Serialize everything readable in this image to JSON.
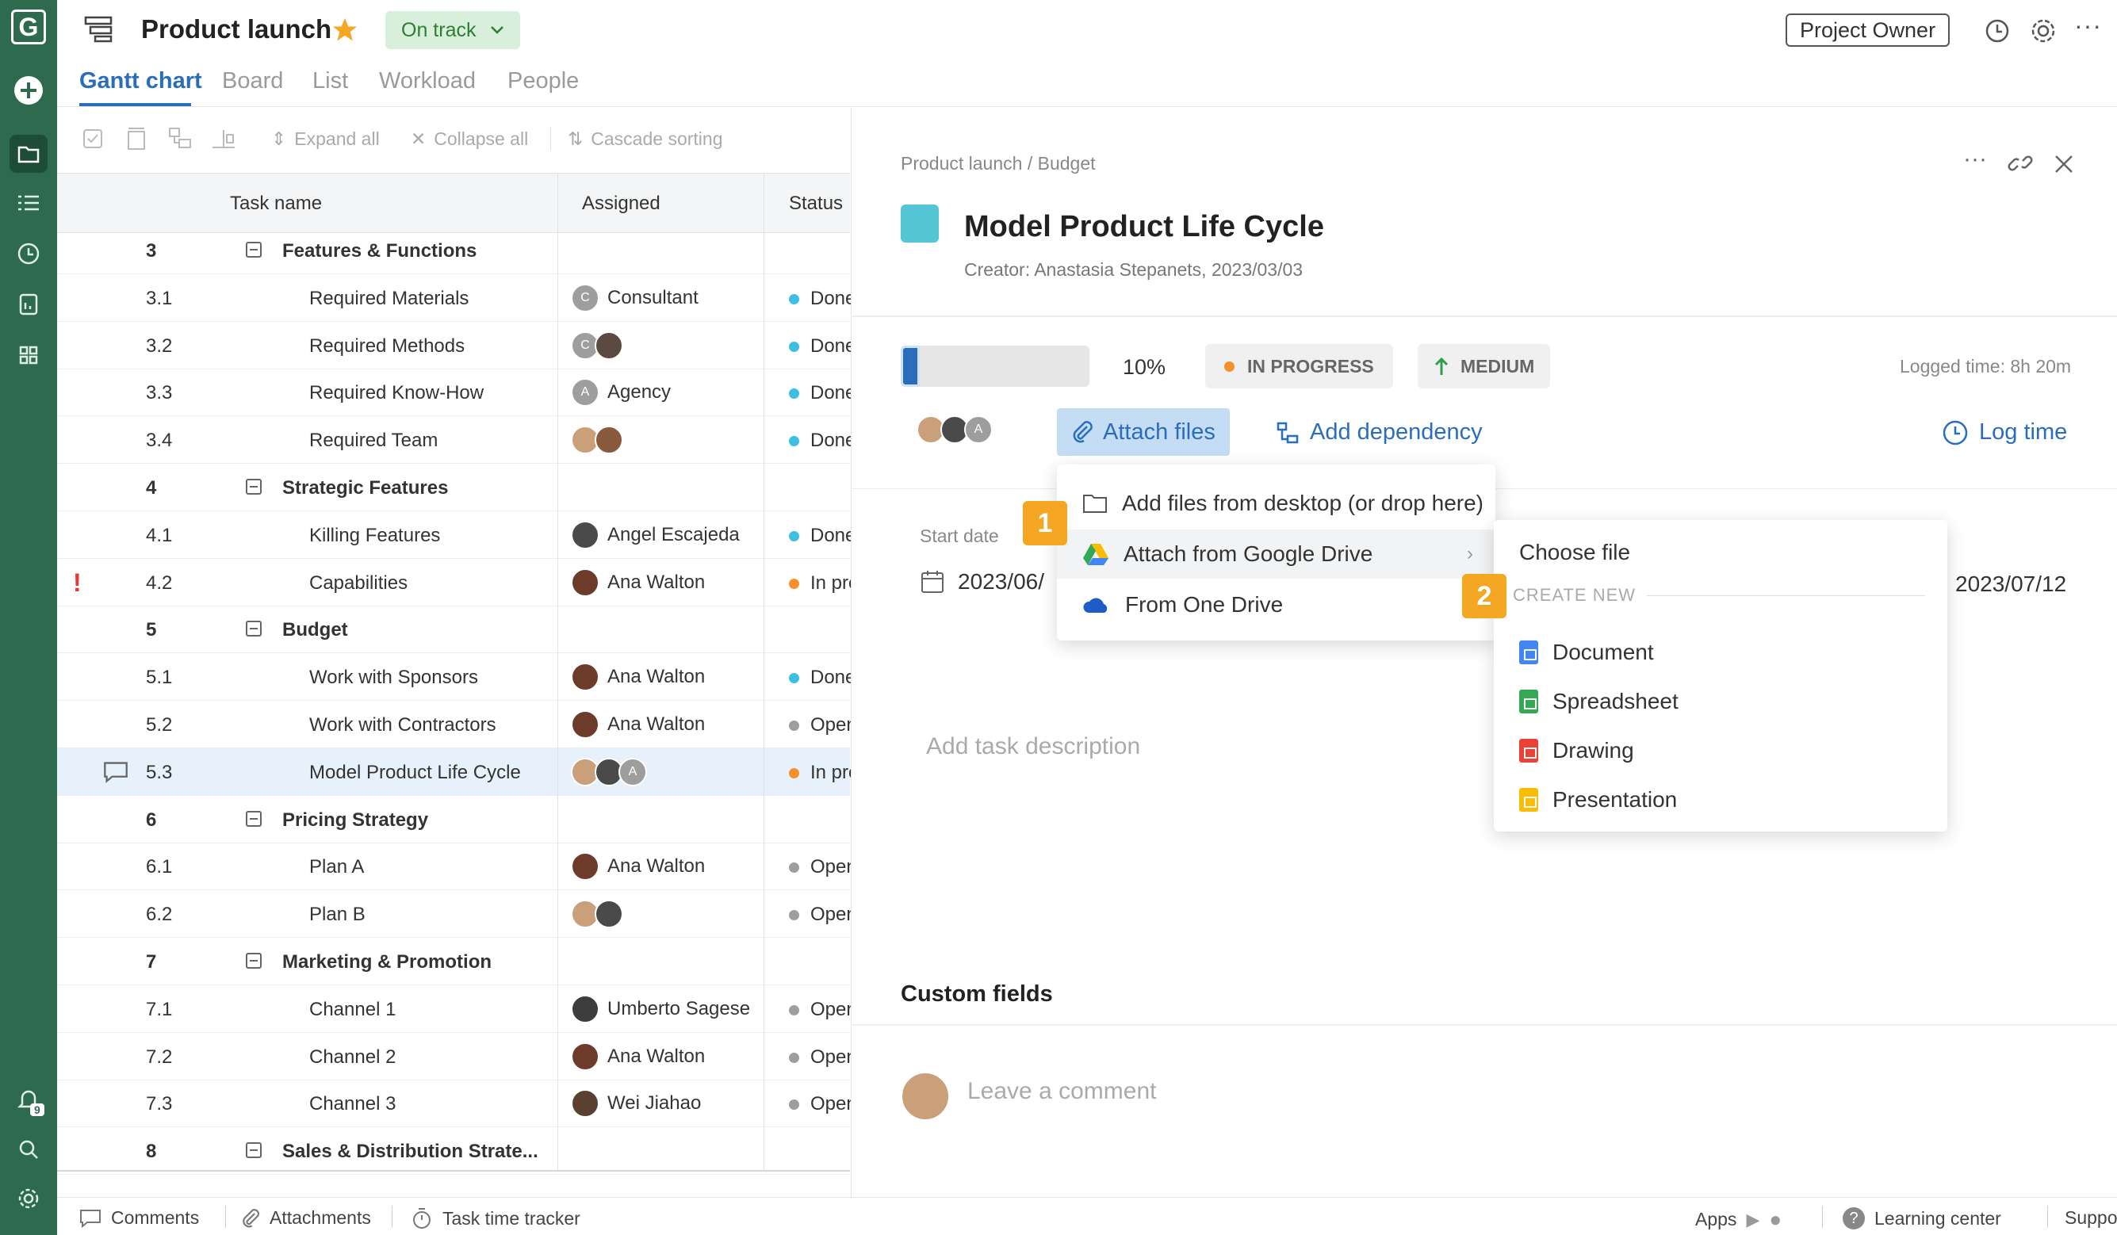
{
  "app": {
    "logo": "G",
    "title": "Product launch",
    "status": "On track",
    "role": "Project Owner",
    "notification_count": "9"
  },
  "tabs": [
    "Gantt chart",
    "Board",
    "List",
    "Workload",
    "People"
  ],
  "toolbar": {
    "expand_all": "Expand all",
    "collapse_all": "Collapse all",
    "cascade_sorting": "Cascade sorting"
  },
  "grid": {
    "columns": [
      "Task name",
      "Assigned",
      "Status"
    ],
    "rows": [
      {
        "num": "3",
        "name": "Features & Functions",
        "parent": true
      },
      {
        "num": "3.1",
        "name": "Required Materials",
        "assignee": "Consultant",
        "avatars": [
          {
            "letter": "C",
            "color": "#9e9e9e"
          }
        ],
        "status": "Done",
        "status_color": "#3cbfe0"
      },
      {
        "num": "3.2",
        "name": "Required Methods",
        "avatars": [
          {
            "letter": "C",
            "color": "#9e9e9e"
          },
          {
            "letter": "",
            "color": "#5b4a3f"
          }
        ],
        "status": "Done",
        "status_color": "#3cbfe0"
      },
      {
        "num": "3.3",
        "name": "Required Know-How",
        "assignee": "Agency",
        "avatars": [
          {
            "letter": "A",
            "color": "#9e9e9e"
          }
        ],
        "status": "Done",
        "status_color": "#3cbfe0"
      },
      {
        "num": "3.4",
        "name": "Required Team",
        "avatars": [
          {
            "letter": "",
            "color": "#c9a07a"
          },
          {
            "letter": "",
            "color": "#8a5a3e"
          }
        ],
        "status": "Done",
        "status_color": "#3cbfe0"
      },
      {
        "num": "4",
        "name": "Strategic Features",
        "parent": true
      },
      {
        "num": "4.1",
        "name": "Killing Features",
        "assignee": "Angel Escajeda",
        "avatars": [
          {
            "letter": "",
            "color": "#4a4a4a"
          }
        ],
        "status": "Done",
        "status_color": "#3cbfe0"
      },
      {
        "num": "4.2",
        "name": "Capabilities",
        "assignee": "Ana Walton",
        "avatars": [
          {
            "letter": "",
            "color": "#6d3b2a"
          }
        ],
        "status": "In progress",
        "status_color": "#f5902a",
        "flag": "!"
      },
      {
        "num": "5",
        "name": "Budget",
        "parent": true
      },
      {
        "num": "5.1",
        "name": "Work with Sponsors",
        "assignee": "Ana Walton",
        "avatars": [
          {
            "letter": "",
            "color": "#6d3b2a"
          }
        ],
        "status": "Done",
        "status_color": "#3cbfe0"
      },
      {
        "num": "5.2",
        "name": "Work with Contractors",
        "assignee": "Ana Walton",
        "avatars": [
          {
            "letter": "",
            "color": "#6d3b2a"
          }
        ],
        "status": "Open",
        "status_color": "#9e9e9e"
      },
      {
        "num": "5.3",
        "name": "Model Product Life Cycle",
        "avatars": [
          {
            "letter": "",
            "color": "#c9a07a"
          },
          {
            "letter": "",
            "color": "#4a4a4a"
          },
          {
            "letter": "A",
            "color": "#9e9e9e"
          }
        ],
        "status": "In progress",
        "status_color": "#f5902a",
        "selected": true,
        "comment": true
      },
      {
        "num": "6",
        "name": "Pricing Strategy",
        "parent": true
      },
      {
        "num": "6.1",
        "name": "Plan A",
        "assignee": "Ana Walton",
        "avatars": [
          {
            "letter": "",
            "color": "#6d3b2a"
          }
        ],
        "status": "Open",
        "status_color": "#9e9e9e"
      },
      {
        "num": "6.2",
        "name": "Plan B",
        "avatars": [
          {
            "letter": "",
            "color": "#c9a07a"
          },
          {
            "letter": "",
            "color": "#4a4a4a"
          }
        ],
        "status": "Open",
        "status_color": "#9e9e9e"
      },
      {
        "num": "7",
        "name": "Marketing & Promotion",
        "parent": true
      },
      {
        "num": "7.1",
        "name": "Channel 1",
        "assignee": "Umberto Sagese",
        "avatars": [
          {
            "letter": "",
            "color": "#3d3d3d"
          }
        ],
        "status": "Open",
        "status_color": "#9e9e9e"
      },
      {
        "num": "7.2",
        "name": "Channel 2",
        "assignee": "Ana Walton",
        "avatars": [
          {
            "letter": "",
            "color": "#6d3b2a"
          }
        ],
        "status": "Open",
        "status_color": "#9e9e9e"
      },
      {
        "num": "7.3",
        "name": "Channel 3",
        "assignee": "Wei Jiahao",
        "avatars": [
          {
            "letter": "",
            "color": "#5a4030"
          }
        ],
        "status": "Open",
        "status_color": "#9e9e9e"
      },
      {
        "num": "8",
        "name": "Sales & Distribution Strate...",
        "parent": true
      }
    ]
  },
  "panel": {
    "breadcrumb": "Product launch / Budget",
    "title": "Model Product Life Cycle",
    "task_color": "#55c6d6",
    "creator": "Creator: Anastasia Stepanets, 2023/03/03",
    "progress_label": "10%",
    "progress_fraction": 0.1,
    "status": "IN PROGRESS",
    "priority": "MEDIUM",
    "logged_time": "Logged time: 8h 20m",
    "attach_label": "Attach files",
    "dependency_label": "Add dependency",
    "log_time_label": "Log time",
    "start_date_label": "Start date",
    "start_date": "2023/06/",
    "end_date": "2023/07/12",
    "description_placeholder": "Add task description",
    "custom_fields": "Custom fields",
    "comment_placeholder": "Leave a comment"
  },
  "attach_menu": {
    "items": [
      "Add files from desktop (or drop here)",
      "Attach from Google Drive",
      "From One Drive"
    ]
  },
  "drive_menu": {
    "choose_file": "Choose file",
    "create_new": "CREATE NEW",
    "items": [
      {
        "label": "Document",
        "color": "#4285f4"
      },
      {
        "label": "Spreadsheet",
        "color": "#34a853"
      },
      {
        "label": "Drawing",
        "color": "#ea4335"
      },
      {
        "label": "Presentation",
        "color": "#fbbc04"
      }
    ]
  },
  "callouts": [
    "1",
    "2"
  ],
  "footer": {
    "comments": "Comments",
    "attachments": "Attachments",
    "time_tracker": "Task time tracker",
    "apps": "Apps",
    "learning": "Learning center",
    "support": "Support"
  },
  "colors": {
    "rail": "#2e6b4e",
    "accent": "#2a6ebb",
    "callout": "#f5a623"
  }
}
